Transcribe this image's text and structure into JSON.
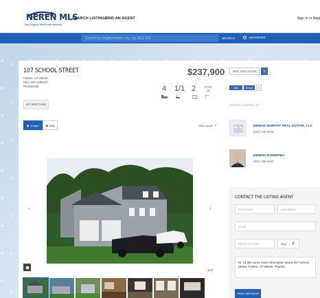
{
  "header": {
    "logo_text": "NEREN MLS",
    "logo_tagline": "New England Real Estate Network",
    "nav": [
      "SEARCH LISTINGS",
      "FIND AN AGENT"
    ],
    "sign_in": "Sign In or Regi"
  },
  "search": {
    "placeholder": "Search by neighborhood, city, zip, MLS ID#",
    "button_label": "SEARCH",
    "advanced_label": "ADVANCED"
  },
  "listing": {
    "address": "107 SCHOOL STREET",
    "city_state": "Fairlee, VT 05045",
    "mls_id": "MLS ID# 4495427",
    "type": "Residential",
    "price": "$237,900",
    "beds": "4",
    "baths": "1/1",
    "garage": "2",
    "sqft": "2704",
    "sqft_unit": "sqft",
    "directions_label": "GET DIRECTIONS"
  },
  "actions": {
    "save_label": "SAVE THIS LISTING",
    "save_count": "0",
    "fb_like": "Like",
    "fb_share": "Share",
    "fb_count": "0"
  },
  "courtesy": {
    "label": "LISTING COURTESY OF",
    "office_name": "DENNIS MURPHY REAL ESTATE, LLC",
    "office_phone": "(802) 333-9648",
    "agent_name": "DENNIS M MURPHY",
    "agent_phone": "(802) 299-6254"
  },
  "gallery": {
    "tab_images": "Images",
    "tab_map": "Map",
    "view_larger": "View Larger",
    "counter": "1/17"
  },
  "contact": {
    "title": "CONTACT THE LISTING AGENT",
    "first_name": "First Name",
    "last_name": "Last Name",
    "email": "Email",
    "phone": "Phone Number",
    "phone_type": "Any",
    "message": "Hi, I'd like some more information about 107 School Street, Fairlee, VT 05045. Thanks!",
    "send_label": "SEND MESSAGE"
  },
  "colors": {
    "brand_blue": "#1f5fb5",
    "navy": "#1b3d78",
    "link": "#1a4f9c"
  }
}
